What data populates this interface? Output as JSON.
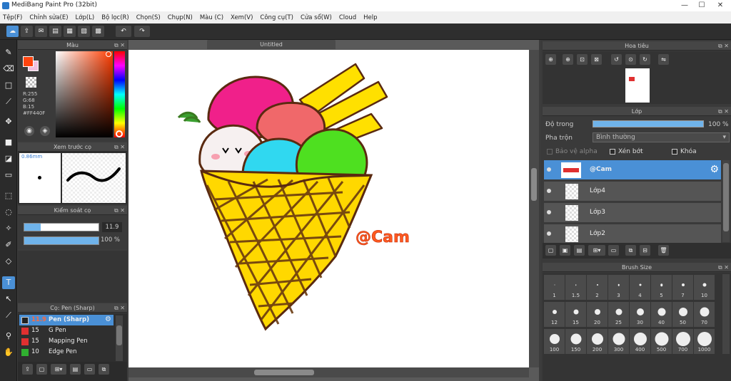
{
  "window": {
    "title": "MediBang Paint Pro (32bit)",
    "min": "—",
    "max": "☐",
    "close": "✕"
  },
  "menu": [
    "Tệp(F)",
    "Chỉnh sửa(E)",
    "Lớp(L)",
    "Bộ lọc(R)",
    "Chọn(S)",
    "Chụp(N)",
    "Màu (C)",
    "Xem(V)",
    "Công cụ(T)",
    "Cửa sổ(W)",
    "Cloud",
    "Help"
  ],
  "color_panel": {
    "title": "Màu",
    "r": "R:255",
    "g": "G:68",
    "b": "B:15",
    "hex": "#FF440F",
    "fg": "#FF440F"
  },
  "brush_preview": {
    "title": "Xem trước cọ",
    "size": "0.86mm"
  },
  "brush_control": {
    "title": "Kiểm soát cọ",
    "size_value": "11.9",
    "opacity_value": "100 %",
    "size_fraction": 0.22,
    "opacity_fraction": 1.0
  },
  "brush_list": {
    "title": "Cọ: Pen (Sharp)",
    "items": [
      {
        "size": "11.9",
        "name": "Pen (Sharp)",
        "color": "#222222",
        "selected": true
      },
      {
        "size": "15",
        "name": "G Pen",
        "color": "#e03030"
      },
      {
        "size": "15",
        "name": "Mapping Pen",
        "color": "#e03030"
      },
      {
        "size": "10",
        "name": "Edge Pen",
        "color": "#30b030"
      }
    ]
  },
  "canvas": {
    "tab_title": "Untitled",
    "watermark": "@Cam"
  },
  "navigator": {
    "title": "Hoa tiêu"
  },
  "layers": {
    "title": "Lớp",
    "opacity_label": "Độ trong",
    "opacity_value": "100 %",
    "blend_label": "Pha trộn",
    "blend_value": "Bình thường",
    "protect_alpha": "Bảo vệ alpha",
    "clipping": "Xén bớt",
    "lock": "Khóa",
    "items": [
      {
        "name": "@Cam",
        "selected": true
      },
      {
        "name": "Lớp4"
      },
      {
        "name": "Lớp3"
      },
      {
        "name": "Lớp2"
      }
    ]
  },
  "brush_size": {
    "title": "Brush Size",
    "sizes": [
      "1",
      "1.5",
      "2",
      "3",
      "4",
      "5",
      "7",
      "10",
      "12",
      "15",
      "20",
      "25",
      "30",
      "40",
      "50",
      "70",
      "100",
      "150",
      "200",
      "300",
      "400",
      "500",
      "700",
      "1000"
    ]
  }
}
